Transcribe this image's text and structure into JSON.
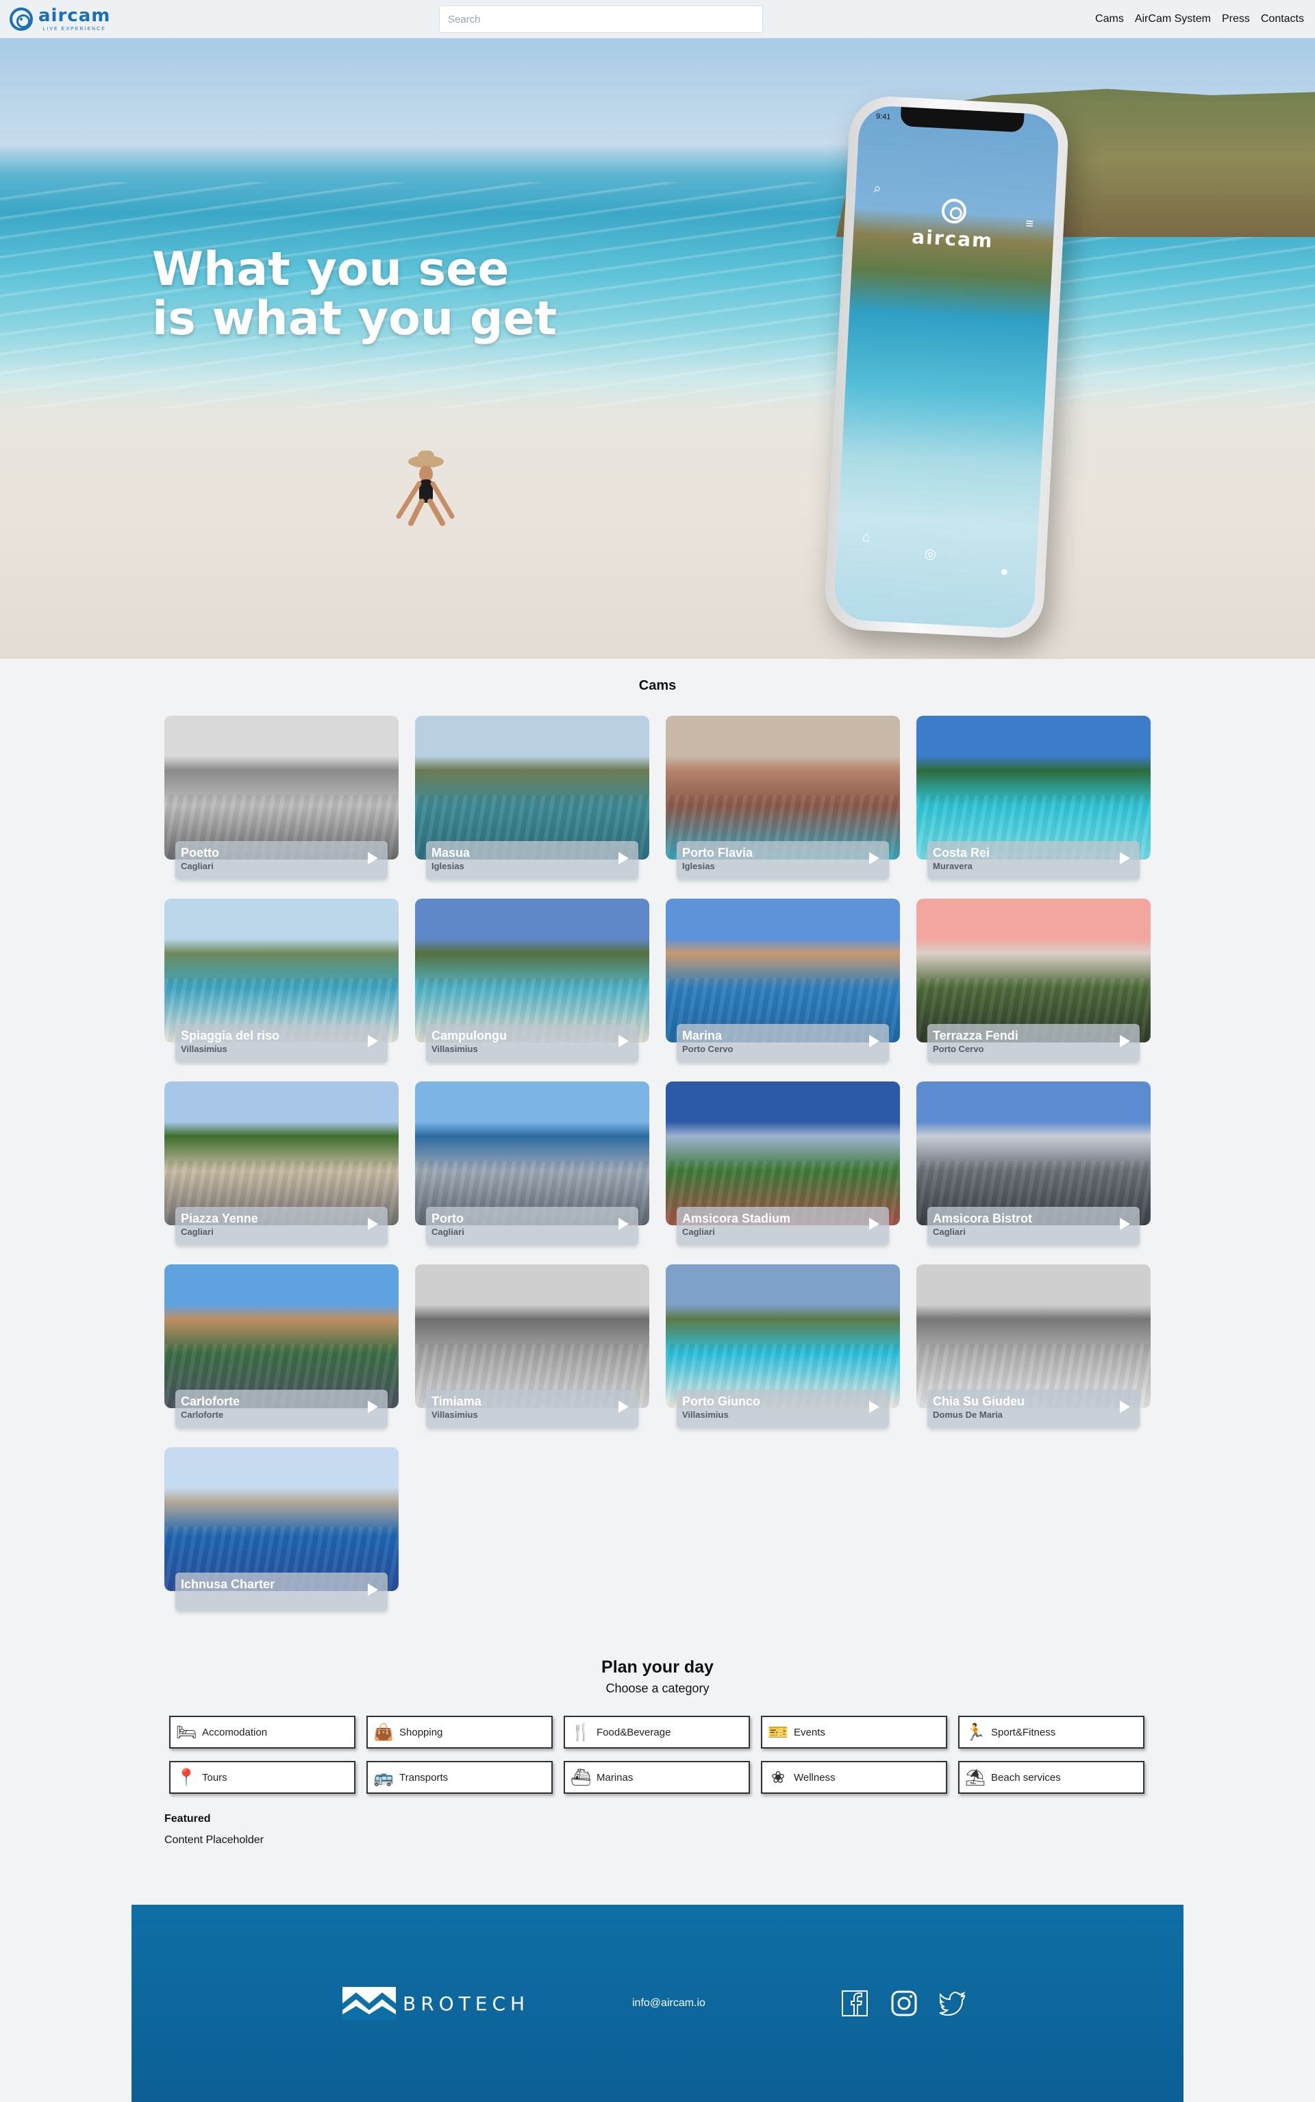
{
  "header": {
    "logo_word": "aircam",
    "logo_tagline": "LIVE EXPERIENCE",
    "search_placeholder": "Search",
    "nav": [
      "Cams",
      "AirCam System",
      "Press",
      "Contacts"
    ]
  },
  "hero": {
    "title_line1": "What you see",
    "title_line2": "is what you get",
    "phone_time": "9:41",
    "phone_logo_word": "aircam"
  },
  "cams": {
    "title": "Cams",
    "items": [
      {
        "name": "Poetto",
        "location": "Cagliari",
        "palette": [
          "#d9d9d9",
          "#8a8a8a",
          "#bdbdbd",
          "#6b6b6b"
        ]
      },
      {
        "name": "Masua",
        "location": "Iglesias",
        "palette": [
          "#b9cfe2",
          "#6b7c52",
          "#3f8b95",
          "#2f6f80"
        ]
      },
      {
        "name": "Porto Flavia",
        "location": "Iglesias",
        "palette": [
          "#c8b8a8",
          "#b5846d",
          "#8c5a4a",
          "#3aa7bf"
        ]
      },
      {
        "name": "Costa Rei",
        "location": "Muravera",
        "palette": [
          "#3b7ccb",
          "#2e6b3c",
          "#30c4d6",
          "#79dde6"
        ]
      },
      {
        "name": "Spiaggia del riso",
        "location": "Villasimius",
        "palette": [
          "#bcd6ea",
          "#6c8a5a",
          "#3fa7c6",
          "#e9e5dc"
        ]
      },
      {
        "name": "Campulongu",
        "location": "Villasimius",
        "palette": [
          "#5f88c9",
          "#56713f",
          "#4fb3c8",
          "#e4ddd0"
        ]
      },
      {
        "name": "Marina",
        "location": "Porto Cervo",
        "palette": [
          "#5f93d9",
          "#c79a6f",
          "#2f7fbf",
          "#1f6aa8"
        ]
      },
      {
        "name": "Terrazza Fendi",
        "location": "Porto Cervo",
        "palette": [
          "#f1a7a0",
          "#dcd1c8",
          "#4e6a3b",
          "#2f3b2a"
        ]
      },
      {
        "name": "Piazza Yenne",
        "location": "Cagliari",
        "palette": [
          "#a7c6e8",
          "#3e6e2c",
          "#c8bba5",
          "#6f6f6f"
        ]
      },
      {
        "name": "Porto",
        "location": "Cagliari",
        "palette": [
          "#7db4e6",
          "#2b6aa0",
          "#9ea9b5",
          "#5d6770"
        ]
      },
      {
        "name": "Amsicora Stadium",
        "location": "Cagliari",
        "palette": [
          "#2c5aa8",
          "#9eb3cf",
          "#3f7a3a",
          "#a8524a"
        ]
      },
      {
        "name": "Amsicora Bistrot",
        "location": "Cagliari",
        "palette": [
          "#5d8bd0",
          "#c9ced6",
          "#6a6f76",
          "#3b4046"
        ]
      },
      {
        "name": "Carloforte",
        "location": "Carloforte",
        "palette": [
          "#5ea2e0",
          "#bf8f64",
          "#3d6d47",
          "#4b5560"
        ]
      },
      {
        "name": "Timiama",
        "location": "Villasimius",
        "palette": [
          "#cfcfcf",
          "#6f6f6f",
          "#a5a5a5",
          "#d8d8d8"
        ]
      },
      {
        "name": "Porto Giunco",
        "location": "Villasimius",
        "palette": [
          "#7fa0c9",
          "#5c7a48",
          "#2ec0dd",
          "#f1ece2"
        ]
      },
      {
        "name": "Chia Su Giudeu",
        "location": "Domus De Maria",
        "palette": [
          "#cfcfcf",
          "#777777",
          "#b0b0b0",
          "#e6e6e6"
        ]
      },
      {
        "name": "Ichnusa Charter",
        "location": "",
        "palette": [
          "#c7dbf0",
          "#b3a897",
          "#1f66b4",
          "#2b4f9a"
        ]
      }
    ]
  },
  "plan": {
    "title": "Plan your day",
    "subtitle": "Choose a category",
    "categories": [
      {
        "label": "Accomodation",
        "icon": "bed-icon"
      },
      {
        "label": "Shopping",
        "icon": "shopping-bag-icon"
      },
      {
        "label": "Food&Beverage",
        "icon": "cutlery-icon"
      },
      {
        "label": "Events",
        "icon": "ticket-icon"
      },
      {
        "label": "Sport&Fitness",
        "icon": "runner-icon"
      },
      {
        "label": "Tours",
        "icon": "map-pin-icon"
      },
      {
        "label": "Transports",
        "icon": "bus-icon"
      },
      {
        "label": "Marinas",
        "icon": "ship-icon"
      },
      {
        "label": "Wellness",
        "icon": "lotus-icon"
      },
      {
        "label": "Beach services",
        "icon": "umbrella-icon"
      }
    ]
  },
  "featured": {
    "title": "Featured",
    "body": "Content Placeholder"
  },
  "footer": {
    "brand": "BROTECH",
    "email": "info@aircam.io",
    "social": [
      "facebook-icon",
      "instagram-icon",
      "twitter-icon"
    ]
  },
  "colors": {
    "brand_blue": "#1a6fb6",
    "footer_blue": "#0e6fa6",
    "page_bg": "#f2f3f5"
  }
}
